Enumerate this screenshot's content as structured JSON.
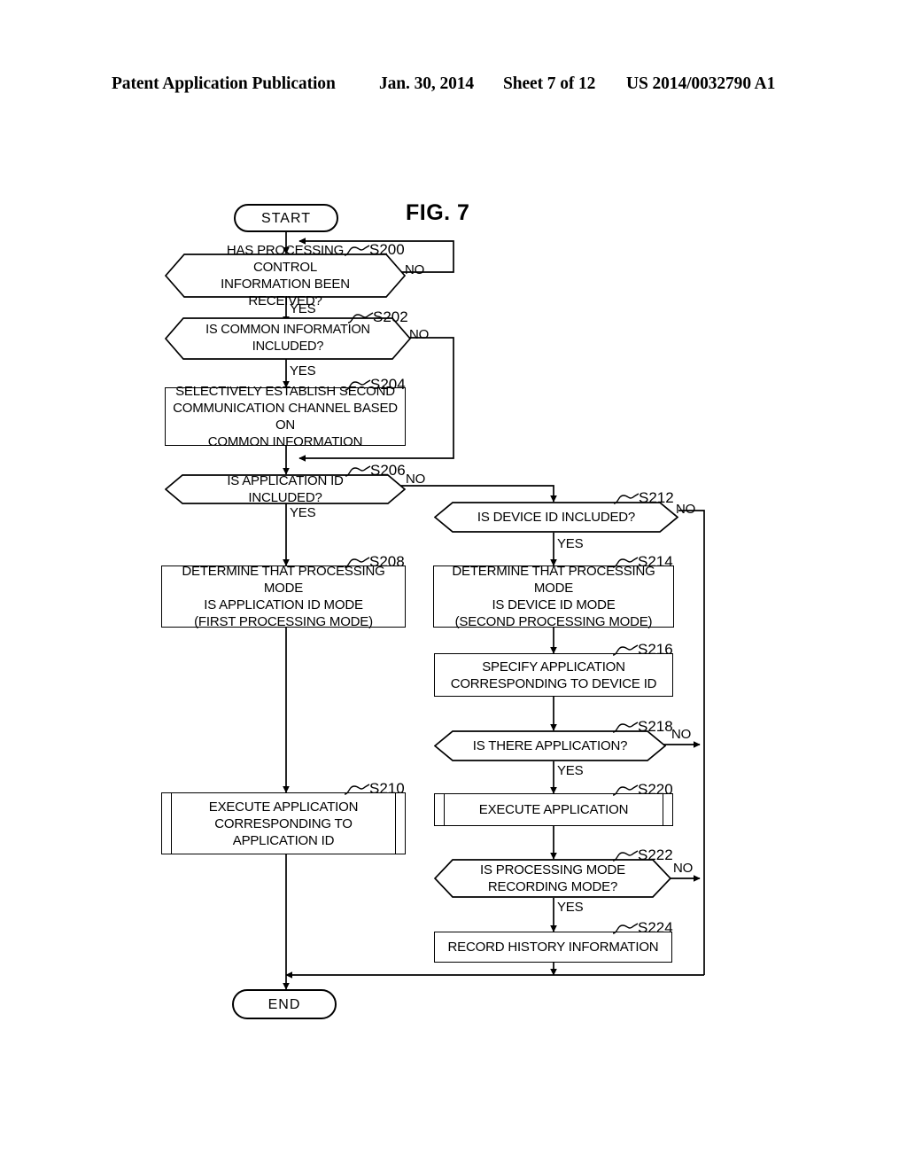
{
  "header": {
    "publication": "Patent Application Publication",
    "date": "Jan. 30, 2014",
    "sheet": "Sheet 7 of 12",
    "number": "US 2014/0032790 A1"
  },
  "figure": {
    "label": "FIG. 7",
    "start_label": "START",
    "end_label": "END",
    "colors": {
      "ink": "#000000",
      "paper": "#ffffff"
    },
    "edge_labels": {
      "yes": "YES",
      "no": "NO"
    },
    "nodes": [
      {
        "id": "start",
        "type": "terminator",
        "text": "START"
      },
      {
        "id": "s200",
        "type": "decision",
        "tag": "S200",
        "text": "HAS PROCESSING CONTROL\nINFORMATION BEEN RECEIVED?",
        "yes": "YES",
        "no": "NO"
      },
      {
        "id": "s202",
        "type": "decision",
        "tag": "S202",
        "text": "IS COMMON INFORMATION INCLUDED?",
        "yes": "YES",
        "no": "NO"
      },
      {
        "id": "s204",
        "type": "process",
        "tag": "S204",
        "text": "SELECTIVELY ESTABLISH SECOND\nCOMMUNICATION CHANNEL BASED ON\nCOMMON INFORMATION"
      },
      {
        "id": "s206",
        "type": "decision",
        "tag": "S206",
        "text": "IS APPLICATION ID INCLUDED?",
        "yes": "YES",
        "no": "NO"
      },
      {
        "id": "s208",
        "type": "process",
        "tag": "S208",
        "text": "DETERMINE THAT PROCESSING MODE\nIS APPLICATION ID MODE\n(FIRST PROCESSING MODE)"
      },
      {
        "id": "s210",
        "type": "predefined",
        "tag": "S210",
        "text": "EXECUTE APPLICATION\nCORRESPONDING TO\nAPPLICATION ID"
      },
      {
        "id": "s212",
        "type": "decision",
        "tag": "S212",
        "text": "IS DEVICE ID INCLUDED?",
        "yes": "YES",
        "no": "NO"
      },
      {
        "id": "s214",
        "type": "process",
        "tag": "S214",
        "text": "DETERMINE THAT PROCESSING MODE\nIS DEVICE ID MODE\n(SECOND PROCESSING MODE)"
      },
      {
        "id": "s216",
        "type": "process",
        "tag": "S216",
        "text": "SPECIFY APPLICATION\nCORRESPONDING TO DEVICE ID"
      },
      {
        "id": "s218",
        "type": "decision",
        "tag": "S218",
        "text": "IS THERE APPLICATION?",
        "yes": "YES",
        "no": "NO"
      },
      {
        "id": "s220",
        "type": "predefined",
        "tag": "S220",
        "text": "EXECUTE APPLICATION"
      },
      {
        "id": "s222",
        "type": "decision",
        "tag": "S222",
        "text": "IS PROCESSING MODE\nRECORDING MODE?",
        "yes": "YES",
        "no": "NO"
      },
      {
        "id": "s224",
        "type": "process",
        "tag": "S224",
        "text": "RECORD HISTORY INFORMATION"
      },
      {
        "id": "end",
        "type": "terminator",
        "text": "END"
      }
    ]
  }
}
